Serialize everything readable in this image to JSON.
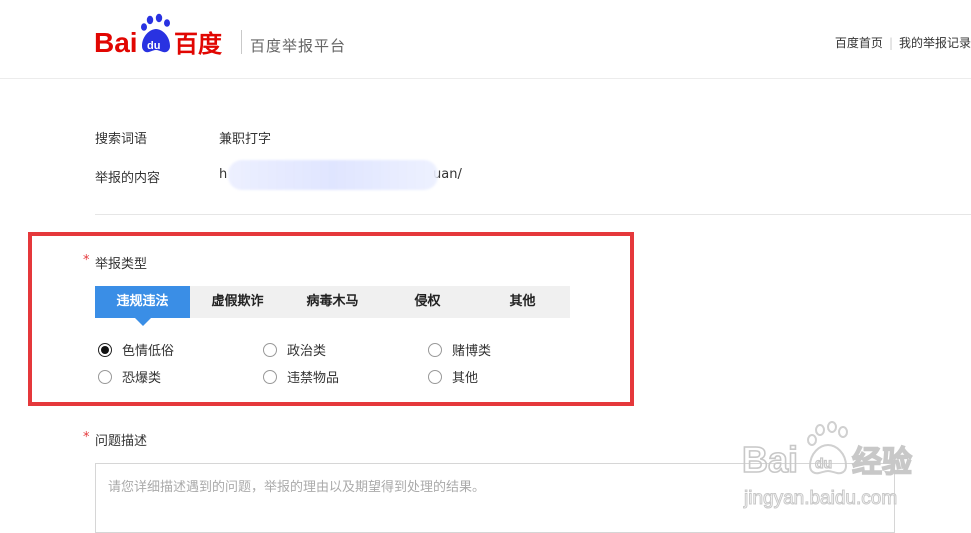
{
  "header": {
    "logo_text_left": "Bai",
    "logo_text_paw": "du",
    "logo_text_right": "百度",
    "platform_name": "百度举报平台",
    "nav": [
      "百度首页",
      "我的举报记录"
    ]
  },
  "info": {
    "search_term_label": "搜索词语",
    "search_term_value": "兼职打字",
    "content_label": "举报的内容",
    "content_value_start": "h",
    "content_value_end": "uan/"
  },
  "report_type": {
    "star": "*",
    "label": "举报类型",
    "tabs": [
      "违规违法",
      "虚假欺诈",
      "病毒木马",
      "侵权",
      "其他"
    ],
    "active_tab": 0,
    "options": [
      "色情低俗",
      "政治类",
      "赌博类",
      "恐爆类",
      "违禁物品",
      "其他"
    ],
    "selected_option": 0
  },
  "description": {
    "star": "*",
    "label": "问题描述",
    "placeholder": "请您详细描述遇到的问题，举报的理由以及期望得到处理的结果。"
  },
  "watermark": {
    "line1": "Bai",
    "line1_paw": "du",
    "line1_cn": "经验",
    "line2": "jingyan.baidu.com"
  },
  "colors": {
    "brand_red": "#e10602",
    "brand_blue": "#2932e1",
    "tab_active": "#3a8ee6",
    "frame_red": "#e5383b"
  }
}
